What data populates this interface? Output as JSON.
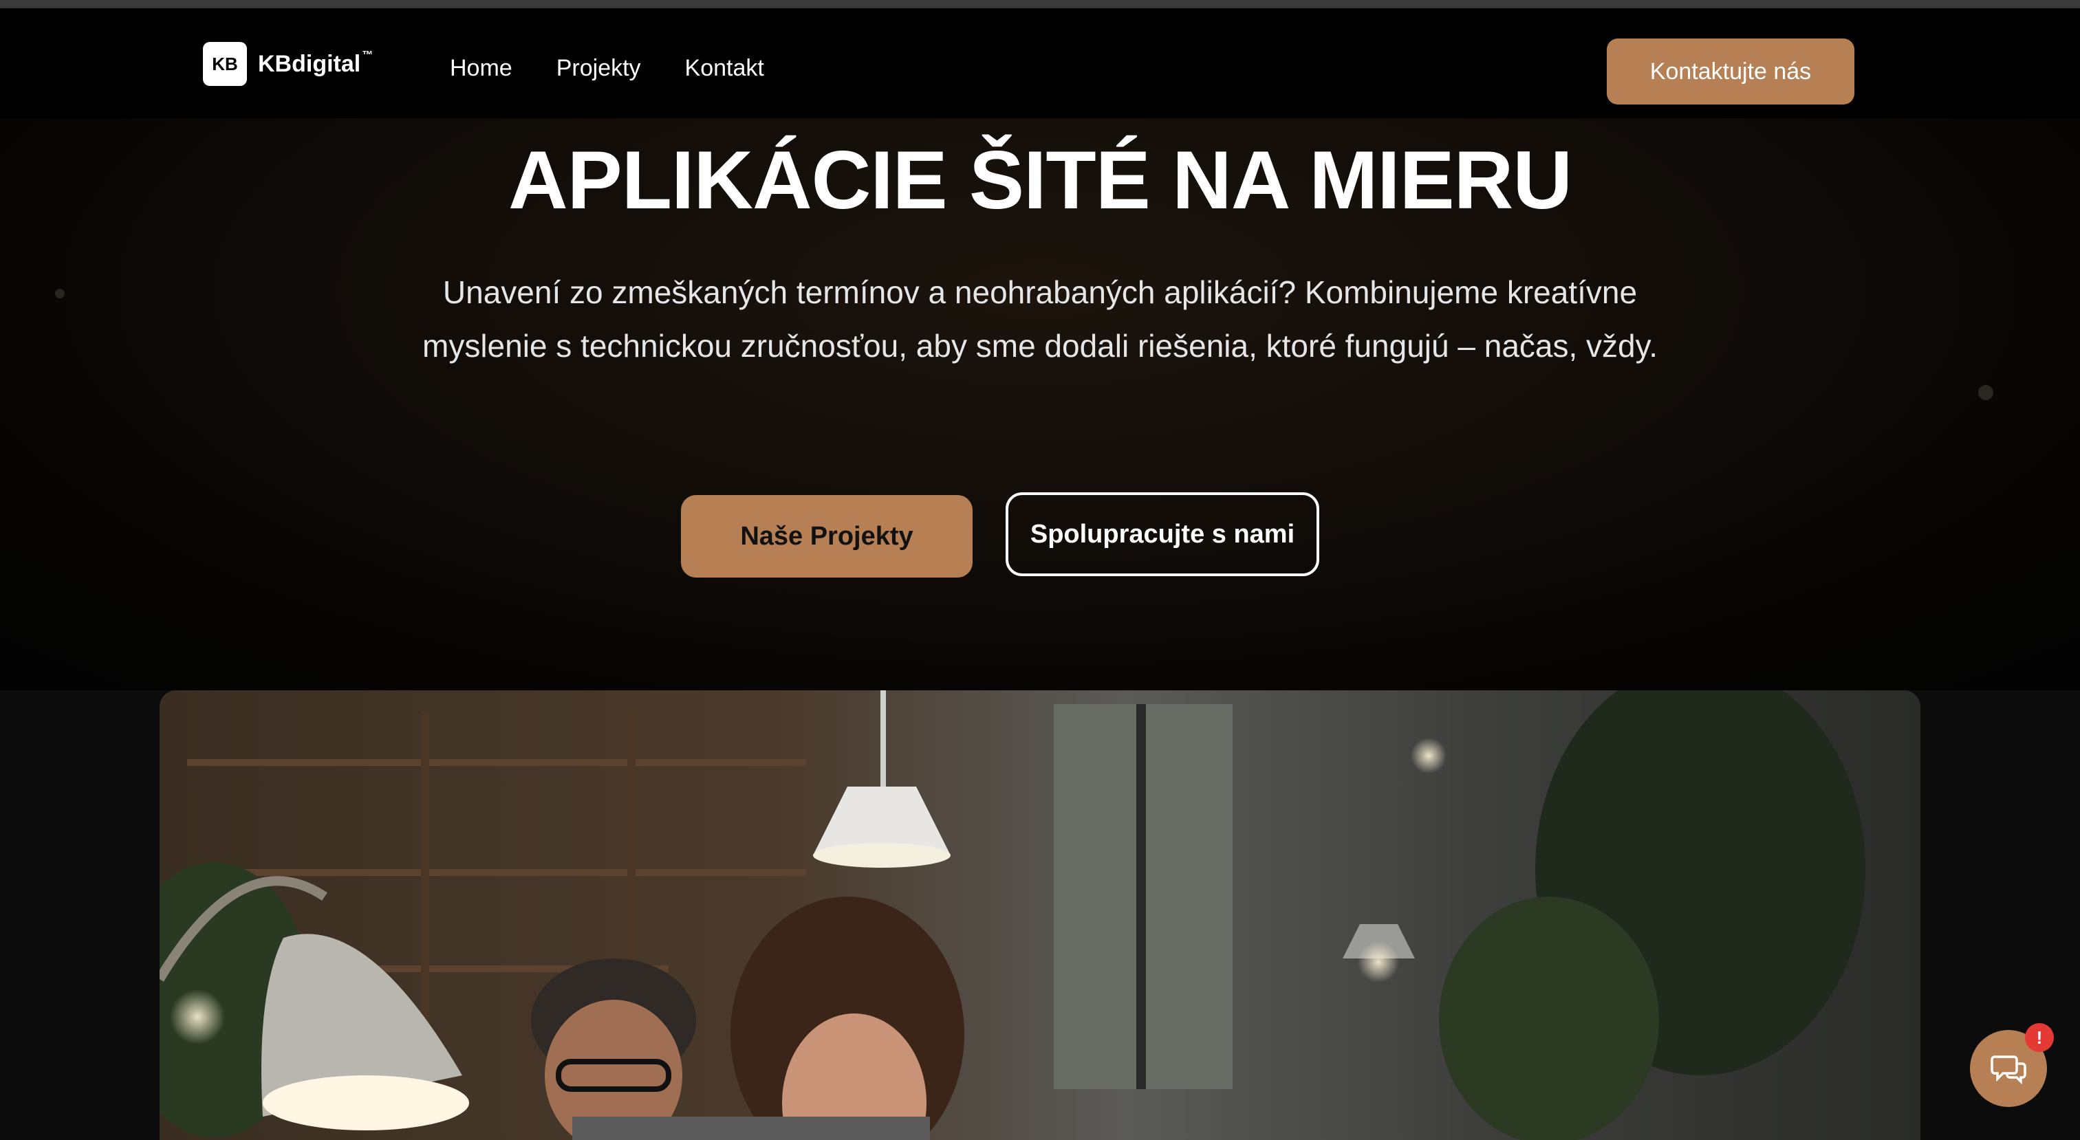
{
  "header": {
    "logo_mark": "KB",
    "logo_name": "KBdigital",
    "logo_tm": "™",
    "nav": [
      {
        "label": "Home"
      },
      {
        "label": "Projekty"
      },
      {
        "label": "Kontakt"
      }
    ],
    "cta_label": "Kontaktujte nás"
  },
  "hero": {
    "title": "APLIKÁCIE ŠITÉ NA MIERU",
    "subtitle": "Unavení zo zmeškaných termínov a neohrabaných aplikácií? Kombinujeme kreatívne myslenie s technickou zručnosťou, aby sme dodali riešenia, ktoré fungujú – načas, vždy.",
    "primary_button": "Naše Projekty",
    "secondary_button": "Spolupracujte s nami"
  },
  "chat": {
    "icon": "chat-bubbles-icon",
    "badge": "!"
  },
  "colors": {
    "accent": "#b67f54",
    "background": "#000000",
    "badge": "#e53935"
  }
}
